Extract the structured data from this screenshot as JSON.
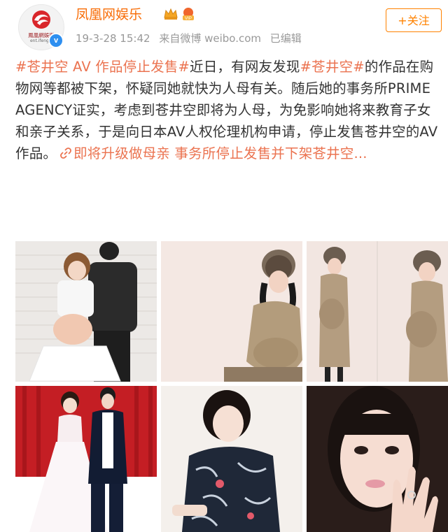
{
  "header": {
    "account_name": "凤凰网娱乐",
    "logo_text": "鳳凰網娛樂",
    "logo_sub": "ent.ifeng.c",
    "timestamp": "19-3-28 15:42",
    "source": "来自微博 weibo.com",
    "edited": "已编辑",
    "follow_label": "+关注",
    "verified_mark": "v"
  },
  "post": {
    "hashtag_1": "#苍井空 AV 作品停止发售#",
    "text_1": "近日，有网友发现",
    "hashtag_2": "#苍井空#",
    "text_2": "的作品在购物网等都被下架，怀疑同她就快为人母有关。随后她的事务所PRIME AGENCY证实，考虑到苍井空即将为人母，为免影响她将来教育子女和亲子关系，于是向日本AV人权伦理机构申请，停止发售苍井空的AV作品。",
    "link_text": "即将升级做母亲 事务所停止发售并下架苍井空...",
    "link_icon": "link-icon"
  },
  "photos": [
    {
      "name": "photo-couple-pregnant"
    },
    {
      "name": "photo-pregnant-seated"
    },
    {
      "name": "photo-pregnant-standing-pair"
    },
    {
      "name": "photo-wedding-couple"
    },
    {
      "name": "photo-kimono"
    },
    {
      "name": "photo-ring-closeup"
    }
  ],
  "colors": {
    "account_name": "#f86d07",
    "hashtag": "#eb7350",
    "follow": "#ff8200",
    "meta": "#999999",
    "verified": "#2e8ff0"
  }
}
